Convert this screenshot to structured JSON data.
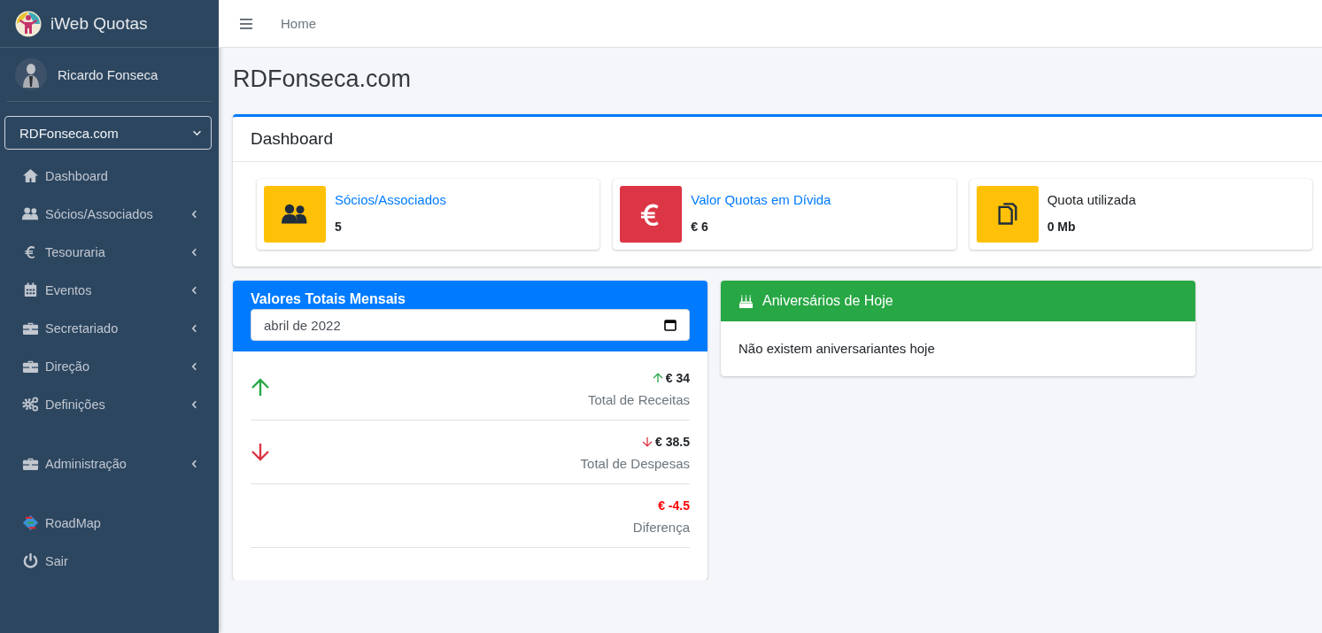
{
  "brand": {
    "title": "iWeb Quotas"
  },
  "user": {
    "name": "Ricardo Fonseca"
  },
  "site_select": {
    "value": "RDFonseca.com"
  },
  "sidebar": {
    "sections": [
      {
        "items": [
          {
            "label": "Dashboard",
            "expandable": false
          },
          {
            "label": "Sócios/Associados",
            "expandable": true
          },
          {
            "label": "Tesouraria",
            "expandable": true
          },
          {
            "label": "Eventos",
            "expandable": true
          },
          {
            "label": "Secretariado",
            "expandable": true
          },
          {
            "label": "Direção",
            "expandable": true
          },
          {
            "label": "Definições",
            "expandable": true
          }
        ]
      },
      {
        "items": [
          {
            "label": "Administração",
            "expandable": true
          }
        ]
      },
      {
        "items": [
          {
            "label": "RoadMap",
            "expandable": false
          },
          {
            "label": "Sair",
            "expandable": false
          }
        ]
      }
    ]
  },
  "topbar": {
    "breadcrumb": "Home"
  },
  "page_title": "RDFonseca.com",
  "dashboard": {
    "title": "Dashboard",
    "info_boxes": [
      {
        "label": "Sócios/Associados",
        "value": "5",
        "color": "#ffc107",
        "link": true
      },
      {
        "label": "Valor Quotas em Dívida",
        "value": "€ 6",
        "color": "#dc3545",
        "link": true
      },
      {
        "label": "Quota utilizada",
        "value": "0 Mb",
        "color": "#ffc107",
        "link": false
      }
    ]
  },
  "totals": {
    "title": "Valores Totais Mensais",
    "month": "abril de 2022",
    "rows": [
      {
        "kind": "income",
        "amount": "€ 34",
        "label": "Total de Receitas"
      },
      {
        "kind": "expense",
        "amount": "€ 38.5",
        "label": "Total de Despesas"
      },
      {
        "kind": "balance",
        "amount": "€ -4.5",
        "label": "Diferença"
      }
    ]
  },
  "birthdays": {
    "title": "Aniversários de Hoje",
    "message": "Não existem aniversariantes hoje"
  }
}
